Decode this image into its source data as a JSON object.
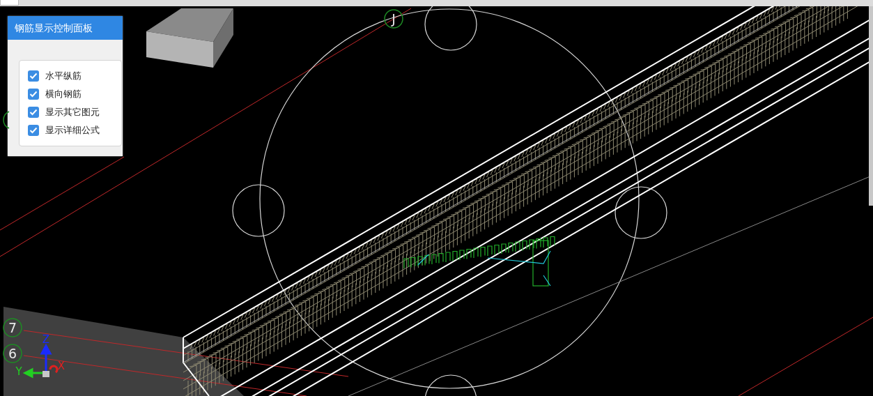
{
  "panel": {
    "title": "钢筋显示控制面板",
    "items": [
      {
        "label": "水平纵筋",
        "checked": true
      },
      {
        "label": "横向钢筋",
        "checked": true
      },
      {
        "label": "显示其它图元",
        "checked": true
      },
      {
        "label": "显示详细公式",
        "checked": true
      }
    ]
  },
  "grid_labels": [
    {
      "label": "J"
    },
    {
      "label": "7"
    },
    {
      "label": "6"
    }
  ],
  "axes": {
    "x": "X",
    "y": "Y",
    "z": "Z"
  }
}
